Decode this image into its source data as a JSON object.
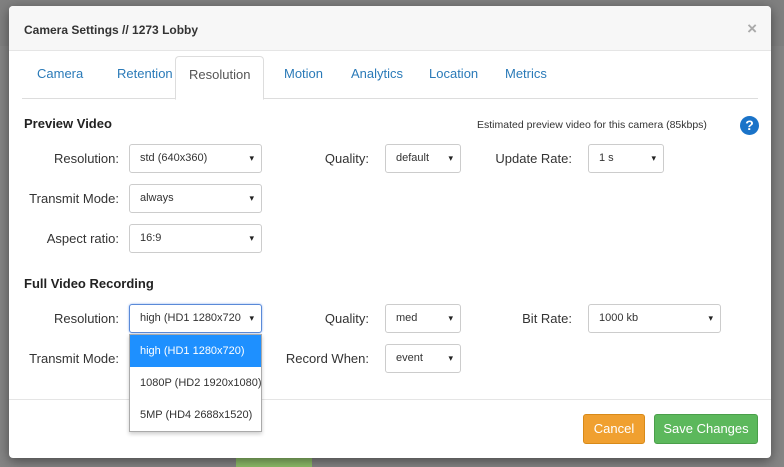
{
  "modal": {
    "title": "Camera Settings // 1273 Lobby",
    "close": "×"
  },
  "tabs": [
    {
      "label": "Camera"
    },
    {
      "label": "Retention"
    },
    {
      "label": "Resolution"
    },
    {
      "label": "Motion"
    },
    {
      "label": "Analytics"
    },
    {
      "label": "Location"
    },
    {
      "label": "Metrics"
    }
  ],
  "preview": {
    "title": "Preview Video",
    "estimate": "Estimated preview video for this camera (85kbps)",
    "help": "?",
    "resolution_label": "Resolution:",
    "resolution_value": "std (640x360)",
    "quality_label": "Quality:",
    "quality_value": "default",
    "update_rate_label": "Update Rate:",
    "update_rate_value": "1 s",
    "transmit_label": "Transmit Mode:",
    "transmit_value": "always",
    "aspect_label": "Aspect ratio:",
    "aspect_value": "16:9"
  },
  "recording": {
    "title": "Full Video Recording",
    "resolution_label": "Resolution:",
    "resolution_value": "high (HD1 1280x720",
    "quality_label": "Quality:",
    "quality_value": "med",
    "bit_rate_label": "Bit Rate:",
    "bit_rate_value": "1000 kb",
    "transmit_label": "Transmit Mode:",
    "record_when_label": "Record When:",
    "record_when_value": "event",
    "resolution_options": [
      "high (HD1 1280x720)",
      "1080P (HD2 1920x1080)",
      "5MP (HD4 2688x1520)"
    ]
  },
  "footer": {
    "cancel": "Cancel",
    "save": "Save Changes"
  },
  "icons": {
    "caret": "▾"
  }
}
